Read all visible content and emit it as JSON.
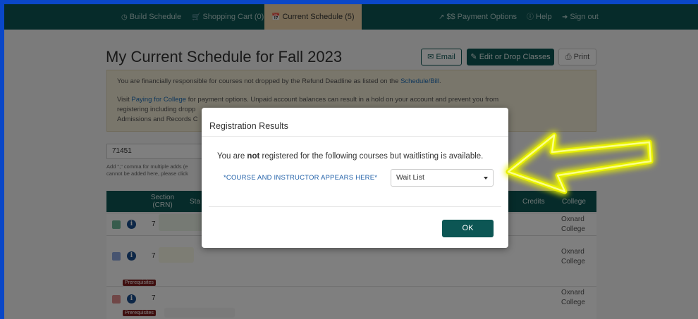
{
  "nav": {
    "build_schedule": "Build Schedule",
    "shopping_cart": "Shopping Cart (0)",
    "current_schedule": "Current Schedule (5)",
    "payment_options": "$$ Payment Options",
    "help": "Help",
    "sign_out": "Sign out"
  },
  "header": {
    "title": "My Current Schedule for Fall 2023",
    "email_label": "Email",
    "edit_label": "Edit or Drop Classes",
    "print_label": "Print"
  },
  "notice": {
    "line1_pre": "You are financially responsible for courses not dropped by the Refund Deadline as listed on the ",
    "line1_link": "Schedule/Bill",
    "line1_post": ".",
    "line2_pre": "Visit ",
    "line2_link": "Paying for College",
    "line2_post": " for payment options. Unpaid account balances can result in a hold on your account and prevent you from",
    "line3": "registering including dropp",
    "line4": "Admissions and Records C"
  },
  "quick_add": {
    "crn_value": "71451",
    "hint_line1": "Add \",\" comma for multiple adds (e",
    "hint_line2": "cannot be added here, please click"
  },
  "table": {
    "col_section": "Section",
    "col_section_sub": "(CRN)",
    "col_status": "Sta",
    "col_credits": "Credits",
    "col_college": "College",
    "rows": [
      {
        "section": "7",
        "college_line1": "Oxnard",
        "college_line2": "College",
        "color": "#6fb89a"
      },
      {
        "section": "7",
        "college_line1": "Oxnard",
        "college_line2": "College",
        "color": "#8fa8e0",
        "prereq": "Prerequisites"
      },
      {
        "section": "7",
        "college_line1": "Oxnard",
        "college_line2": "College",
        "color": "#e08f8f",
        "prereq": "Prerequisites"
      }
    ]
  },
  "modal": {
    "title": "Registration Results",
    "msg_pre": "You are ",
    "msg_bold": "not",
    "msg_post": " registered for the following courses but waitlisting is available.",
    "course_label": "*COURSE AND INSTRUCTOR APPEARS HERE*",
    "select_value": "Wait List",
    "ok_label": "OK"
  },
  "colors": {
    "primary": "#0c5654",
    "annotation_arrow": "#e8f000",
    "border": "#0a47c8"
  }
}
